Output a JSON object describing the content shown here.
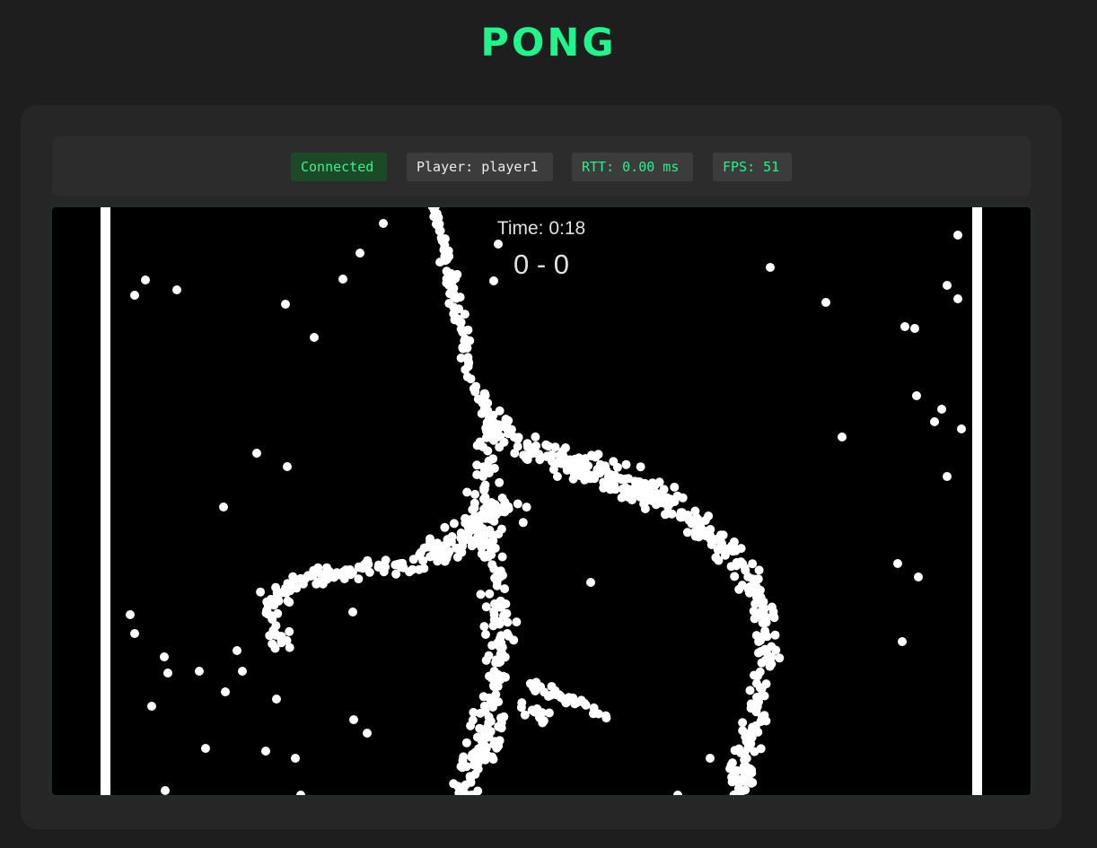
{
  "app": {
    "title": "PONG"
  },
  "status": {
    "connection": "Connected",
    "player": "Player: player1",
    "rtt": "RTT: 0.00 ms",
    "fps": "FPS: 51"
  },
  "game": {
    "timer": "Time: 0:18",
    "score": "0 - 0"
  },
  "colors": {
    "accent": "#1ff58a",
    "background": "#1e1e1e",
    "panel": "#262626",
    "field": "#000000",
    "ball": "#ffffff"
  }
}
